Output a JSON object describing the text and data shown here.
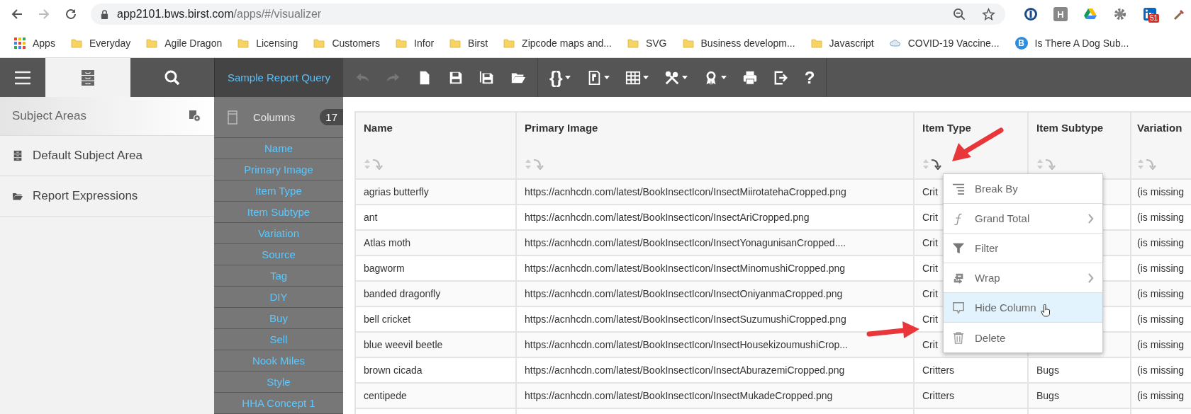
{
  "browser": {
    "url_host": "app2101.bws.birst.com",
    "url_path": "/apps/#/visualizer",
    "extensions": [
      {
        "kind": "password"
      },
      {
        "kind": "letter",
        "letter": "H"
      },
      {
        "kind": "drive"
      },
      {
        "kind": "gear"
      },
      {
        "kind": "linkedin",
        "badge": "51"
      },
      {
        "kind": "dropper"
      }
    ],
    "bookmarks": [
      {
        "label": "Apps",
        "kind": "apps"
      },
      {
        "label": "Everyday",
        "kind": "folder"
      },
      {
        "label": "Agile Dragon",
        "kind": "folder"
      },
      {
        "label": "Licensing",
        "kind": "folder"
      },
      {
        "label": "Customers",
        "kind": "folder"
      },
      {
        "label": "Infor",
        "kind": "folder"
      },
      {
        "label": "Birst",
        "kind": "folder"
      },
      {
        "label": "Zipcode maps and...",
        "kind": "folder"
      },
      {
        "label": "SVG",
        "kind": "folder"
      },
      {
        "label": "Business developm...",
        "kind": "folder"
      },
      {
        "label": "Javascript",
        "kind": "folder"
      },
      {
        "label": "COVID-19 Vaccine...",
        "kind": "cloud"
      },
      {
        "label": "Is There A Dog Sub...",
        "kind": "letter",
        "letter": "B"
      }
    ]
  },
  "sidebar_tabs": [
    {
      "kind": "menu",
      "selected": false
    },
    {
      "kind": "cabinet",
      "selected": true
    },
    {
      "kind": "search",
      "selected": false
    }
  ],
  "query_title": "Sample Report Query",
  "toolbar_groups": [
    [
      {
        "kind": "undo",
        "disabled": true,
        "dropdown": false
      },
      {
        "kind": "redo",
        "disabled": true,
        "dropdown": false
      },
      {
        "kind": "new",
        "disabled": false,
        "dropdown": false
      },
      {
        "kind": "save",
        "disabled": false,
        "dropdown": false
      },
      {
        "kind": "save-as",
        "disabled": false,
        "dropdown": false
      },
      {
        "kind": "open",
        "disabled": false,
        "dropdown": false
      }
    ],
    [
      {
        "kind": "glyph",
        "glyph": "{}",
        "disabled": false,
        "dropdown": true
      },
      {
        "kind": "layout",
        "disabled": false,
        "dropdown": true
      },
      {
        "kind": "grid",
        "disabled": false,
        "dropdown": true
      },
      {
        "kind": "tools",
        "disabled": false,
        "dropdown": true
      },
      {
        "kind": "award",
        "disabled": false,
        "dropdown": true
      },
      {
        "kind": "print",
        "disabled": false,
        "dropdown": false
      },
      {
        "kind": "export",
        "disabled": false,
        "dropdown": false
      },
      {
        "kind": "glyph",
        "glyph": "?",
        "disabled": false,
        "dropdown": false
      }
    ]
  ],
  "subject_areas": {
    "title": "Subject Areas",
    "items": [
      {
        "label": "Default Subject Area",
        "kind": "cabinet"
      },
      {
        "label": "Report Expressions",
        "kind": "folder"
      }
    ]
  },
  "columns_panel": {
    "title": "Columns",
    "count": "17",
    "items": [
      "Name",
      "Primary Image",
      "Item Type",
      "Item Subtype",
      "Variation",
      "Source",
      "Tag",
      "DIY",
      "Buy",
      "Sell",
      "Nook Miles",
      "Style",
      "HHA Concept 1"
    ]
  },
  "table": {
    "columns": [
      {
        "label": "Name",
        "menu_open": false
      },
      {
        "label": "Primary Image",
        "menu_open": false
      },
      {
        "label": "Item Type",
        "menu_open": true
      },
      {
        "label": "Item Subtype",
        "menu_open": false
      },
      {
        "label": "Variation",
        "menu_open": false
      }
    ],
    "rows": [
      [
        "agrias butterfly",
        "https://acnhcdn.com/latest/BookInsectIcon/InsectMiirotatehaCropped.png",
        "Crit",
        null,
        "(is missing"
      ],
      [
        "ant",
        "https://acnhcdn.com/latest/BookInsectIcon/InsectAriCropped.png",
        "Crit",
        null,
        "(is missing"
      ],
      [
        "Atlas moth",
        "https://acnhcdn.com/latest/BookInsectIcon/InsectYonagunisanCropped....",
        "Crit",
        null,
        "(is missing"
      ],
      [
        "bagworm",
        "https://acnhcdn.com/latest/BookInsectIcon/InsectMinomushiCropped.png",
        "Crit",
        null,
        "(is missing"
      ],
      [
        "banded dragonfly",
        "https://acnhcdn.com/latest/BookInsectIcon/InsectOniyanmaCropped.png",
        "Crit",
        null,
        "(is missing"
      ],
      [
        "bell cricket",
        "https://acnhcdn.com/latest/BookInsectIcon/InsectSuzumushiCropped.png",
        "Crit",
        null,
        "(is missing"
      ],
      [
        "blue weevil beetle",
        "https://acnhcdn.com/latest/BookInsectIcon/InsectHousekizoumushiCrop...",
        "Crit",
        null,
        "(is missing"
      ],
      [
        "brown cicada",
        "https://acnhcdn.com/latest/BookInsectIcon/InsectAburazemiCropped.png",
        "Critters",
        "Bugs",
        "(is missing"
      ],
      [
        "centipede",
        "https://acnhcdn.com/latest/BookInsectIcon/InsectMukadeCropped.png",
        "Critters",
        "Bugs",
        "(is missing"
      ]
    ]
  },
  "column_menu": {
    "items": [
      {
        "label": "Break By",
        "kind": "break",
        "submenu": false,
        "highlighted": false
      },
      {
        "label": "Grand Total",
        "kind": "function",
        "submenu": true,
        "highlighted": false
      },
      {
        "label": "Filter",
        "kind": "filter",
        "submenu": false,
        "highlighted": false
      },
      {
        "label": "Wrap",
        "kind": "wrap",
        "submenu": true,
        "highlighted": false
      },
      {
        "label": "Hide Column",
        "kind": "hide",
        "submenu": false,
        "highlighted": true
      },
      {
        "label": "Delete",
        "kind": "delete",
        "submenu": false,
        "highlighted": false
      }
    ]
  }
}
